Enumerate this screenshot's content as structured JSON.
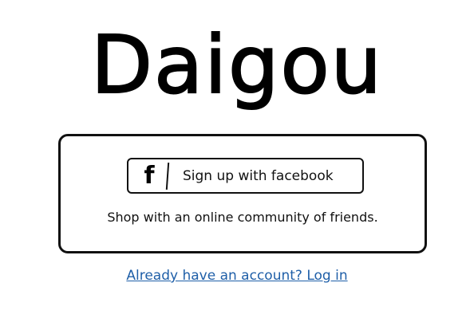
{
  "app": {
    "title": "Daigou"
  },
  "signup": {
    "facebook_icon_glyph": "f",
    "facebook_button_label": "Sign up with facebook",
    "tagline": "Shop with an online community of friends."
  },
  "login": {
    "link_text": "Already have an account? Log in"
  },
  "colors": {
    "link": "#1f5fa8",
    "border": "#111111",
    "text": "#111111"
  },
  "icons": {
    "facebook": "facebook-icon"
  }
}
